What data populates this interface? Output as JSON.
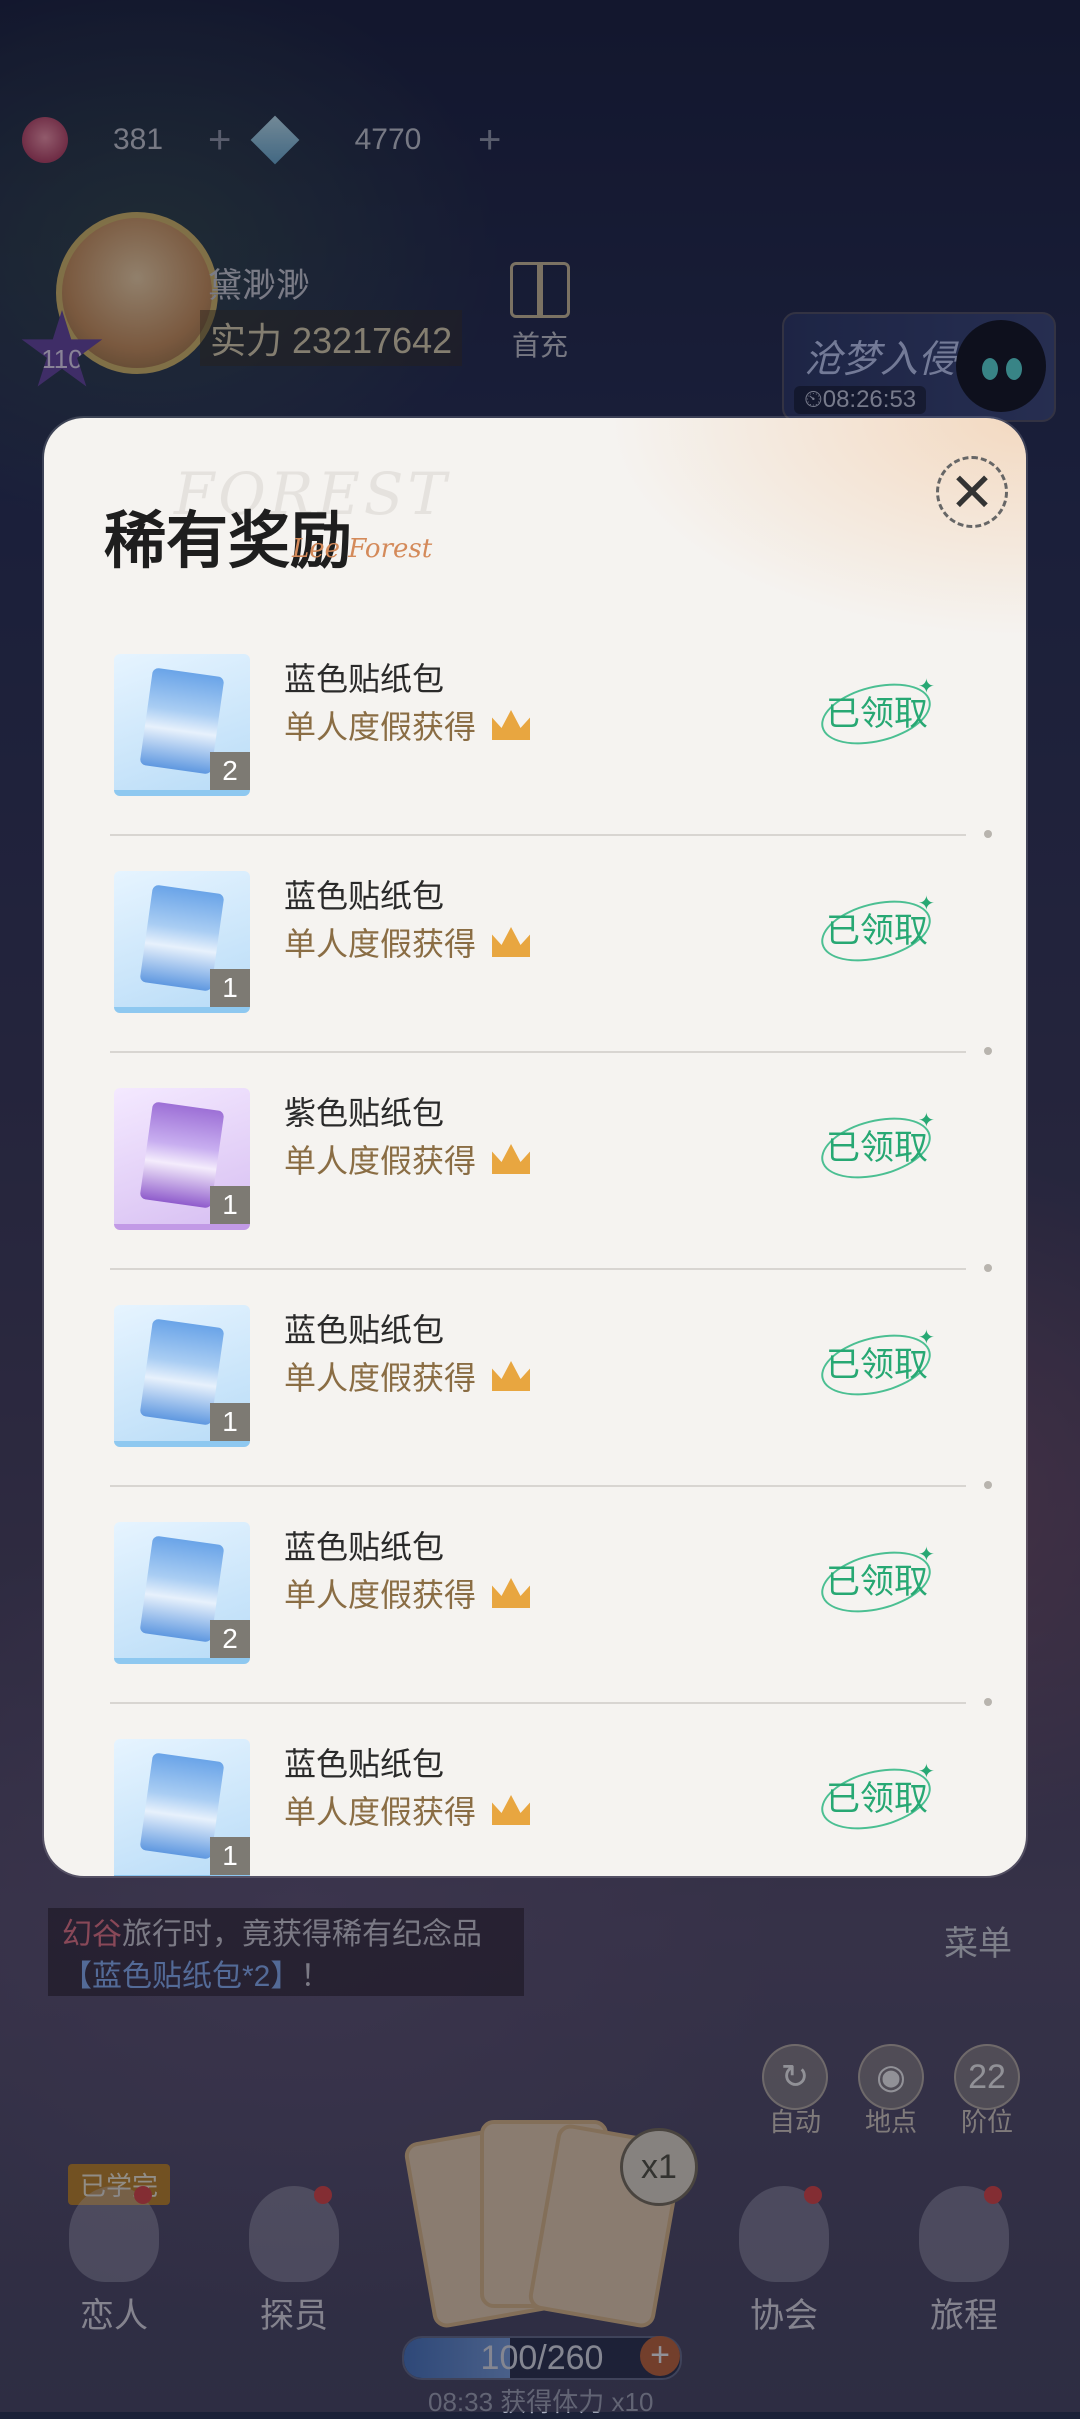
{
  "hud": {
    "hearts": "381",
    "gems": "4770",
    "plus": "+",
    "player_level": "110",
    "player_name": "黛渺渺",
    "player_power": "实力 23217642",
    "first_charge_label": "首充",
    "event_title": "沧梦入侵",
    "event_timer": "⏲08:26:53"
  },
  "modal": {
    "title": "稀有奖励",
    "watermark": "FOREST",
    "signature": "Lee Forest",
    "close_symbol": "✕",
    "items": [
      {
        "name": "蓝色贴纸包",
        "source": "单人度假获得",
        "qty": "2",
        "status": "已领取",
        "color": "blue"
      },
      {
        "name": "蓝色贴纸包",
        "source": "单人度假获得",
        "qty": "1",
        "status": "已领取",
        "color": "blue"
      },
      {
        "name": "紫色贴纸包",
        "source": "单人度假获得",
        "qty": "1",
        "status": "已领取",
        "color": "purple"
      },
      {
        "name": "蓝色贴纸包",
        "source": "单人度假获得",
        "qty": "1",
        "status": "已领取",
        "color": "blue"
      },
      {
        "name": "蓝色贴纸包",
        "source": "单人度假获得",
        "qty": "2",
        "status": "已领取",
        "color": "blue"
      },
      {
        "name": "蓝色贴纸包",
        "source": "单人度假获得",
        "qty": "1",
        "status": "已领取",
        "color": "blue"
      }
    ]
  },
  "toast": {
    "place": "幻谷",
    "line1_rest": "旅行时，竟获得稀有纪念品",
    "item": "【蓝色贴纸包*2】",
    "end": "！"
  },
  "menu_label": "菜单",
  "quick_buttons": [
    {
      "label": "自动",
      "icon": "refresh-icon",
      "glyph": "↻"
    },
    {
      "label": "地点",
      "icon": "location-pin-icon",
      "glyph": "◉"
    },
    {
      "label": "阶位",
      "icon": "rank-icon",
      "glyph": "22"
    }
  ],
  "nav": [
    {
      "label": "恋人",
      "icon": "lover-icon"
    },
    {
      "label": "探员",
      "icon": "agent-icon"
    },
    {
      "label": "协会",
      "icon": "association-icon"
    },
    {
      "label": "旅程",
      "icon": "journey-icon"
    }
  ],
  "learned_tag": "已学完",
  "multiplier": "x1",
  "stamina": {
    "text": "100/260",
    "current": 100,
    "max": 260,
    "timer_info": "08:33  获得体力  x10",
    "plus": "+"
  }
}
